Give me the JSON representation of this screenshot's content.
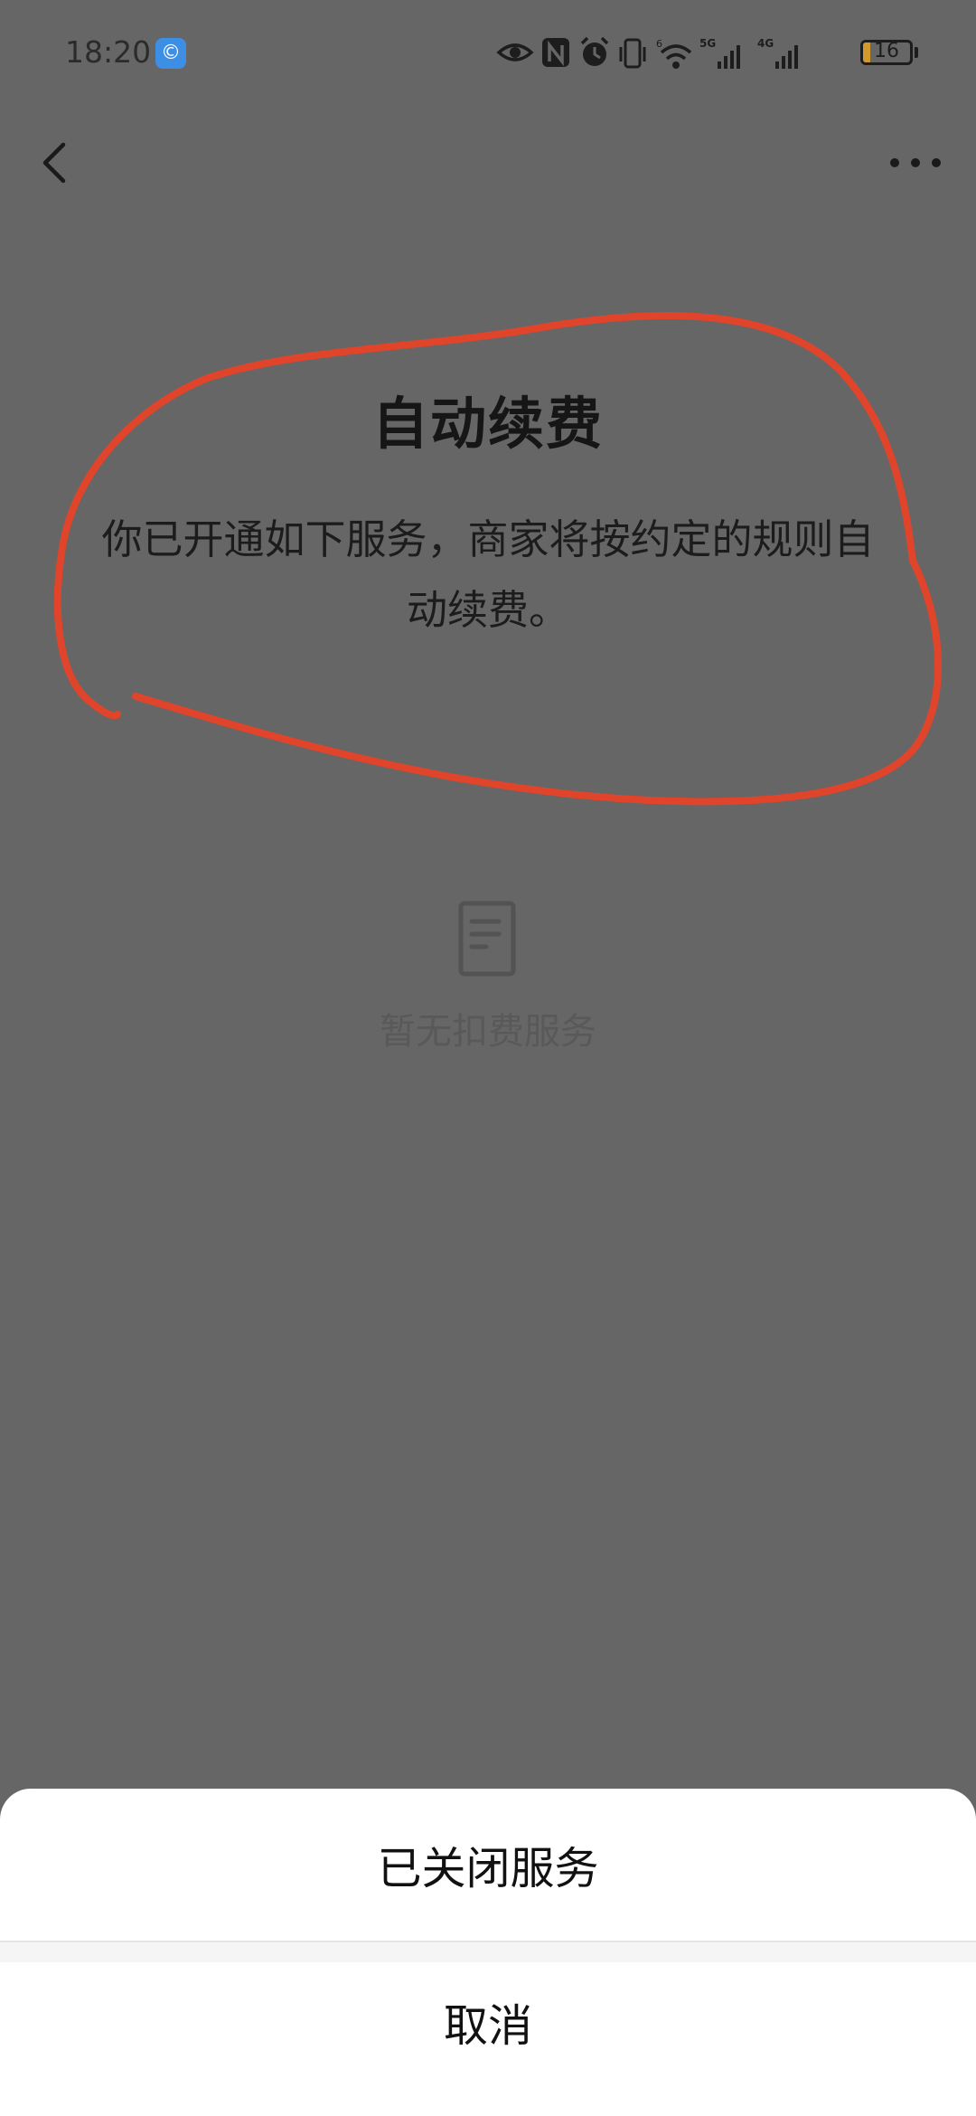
{
  "status_bar": {
    "time": "18:20",
    "app_badge": "©",
    "battery_level": "16",
    "battery_fraction": 0.16,
    "icons": [
      "eye-icon",
      "nfc-icon",
      "alarm-icon",
      "vibrate-icon",
      "wifi-icon",
      "signal-5g-icon",
      "signal-4g-icon",
      "battery-icon"
    ]
  },
  "nav": {
    "back_icon": "chevron-left-icon",
    "more_icon": "more-horizontal-icon"
  },
  "header": {
    "title": "自动续费",
    "description": "你已开通如下服务，商家将按约定的规则自动续费。"
  },
  "empty_state": {
    "icon": "document-icon",
    "text": "暂无扣费服务"
  },
  "bottom_sheet": {
    "option_label": "已关闭服务",
    "cancel_label": "取消"
  },
  "colors": {
    "overlay_background": "#666666",
    "annotation_stroke": "#e0442a",
    "sheet_background": "#ffffff",
    "battery_fill": "#d19a2e",
    "app_badge": "#3d8fe6"
  }
}
